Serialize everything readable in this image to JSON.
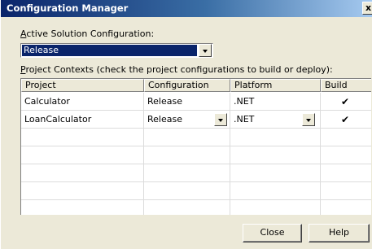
{
  "window": {
    "title": "Configuration Manager",
    "close_label": "x"
  },
  "active_config": {
    "label_accel": "A",
    "label_rest": "ctive Solution Configuration:",
    "selected_value": "Release"
  },
  "project_contexts": {
    "label_accel": "P",
    "label_rest": "roject Contexts (check the project configurations to build or deploy):"
  },
  "table": {
    "headers": [
      "Project",
      "Configuration",
      "Platform",
      "Build"
    ],
    "rows": [
      {
        "project": "Calculator",
        "configuration": "Release",
        "platform": ".NET",
        "build": "✔"
      },
      {
        "project": "LoanCalculator",
        "configuration": "Release",
        "platform": ".NET",
        "build": "✔"
      }
    ]
  },
  "buttons": {
    "close": "Close",
    "help": "Help"
  }
}
